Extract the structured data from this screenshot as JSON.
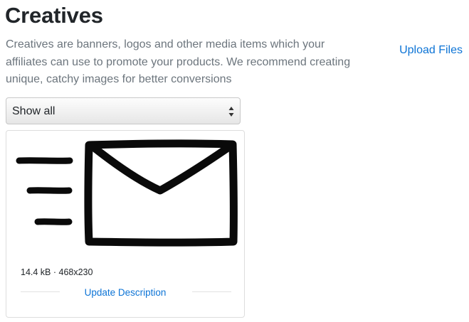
{
  "header": {
    "title": "Creatives",
    "description": "Creatives are banners, logos and other media items which your affiliates can use to promote your products. We recommend creating unique, catchy images for better conversions",
    "upload_label": "Upload Files"
  },
  "filter": {
    "selected": "Show all",
    "icon": "select-arrows-icon"
  },
  "creatives": [
    {
      "image_icon": "mail-envelope-icon",
      "size": "14.4 kB",
      "dimensions": "468x230",
      "meta_text": "14.4 kB · 468x230",
      "action_label": "Update Description"
    }
  ],
  "colors": {
    "link": "#0d74d6",
    "muted_text": "#6c757d",
    "heading": "#212529",
    "border": "#dddddd"
  }
}
